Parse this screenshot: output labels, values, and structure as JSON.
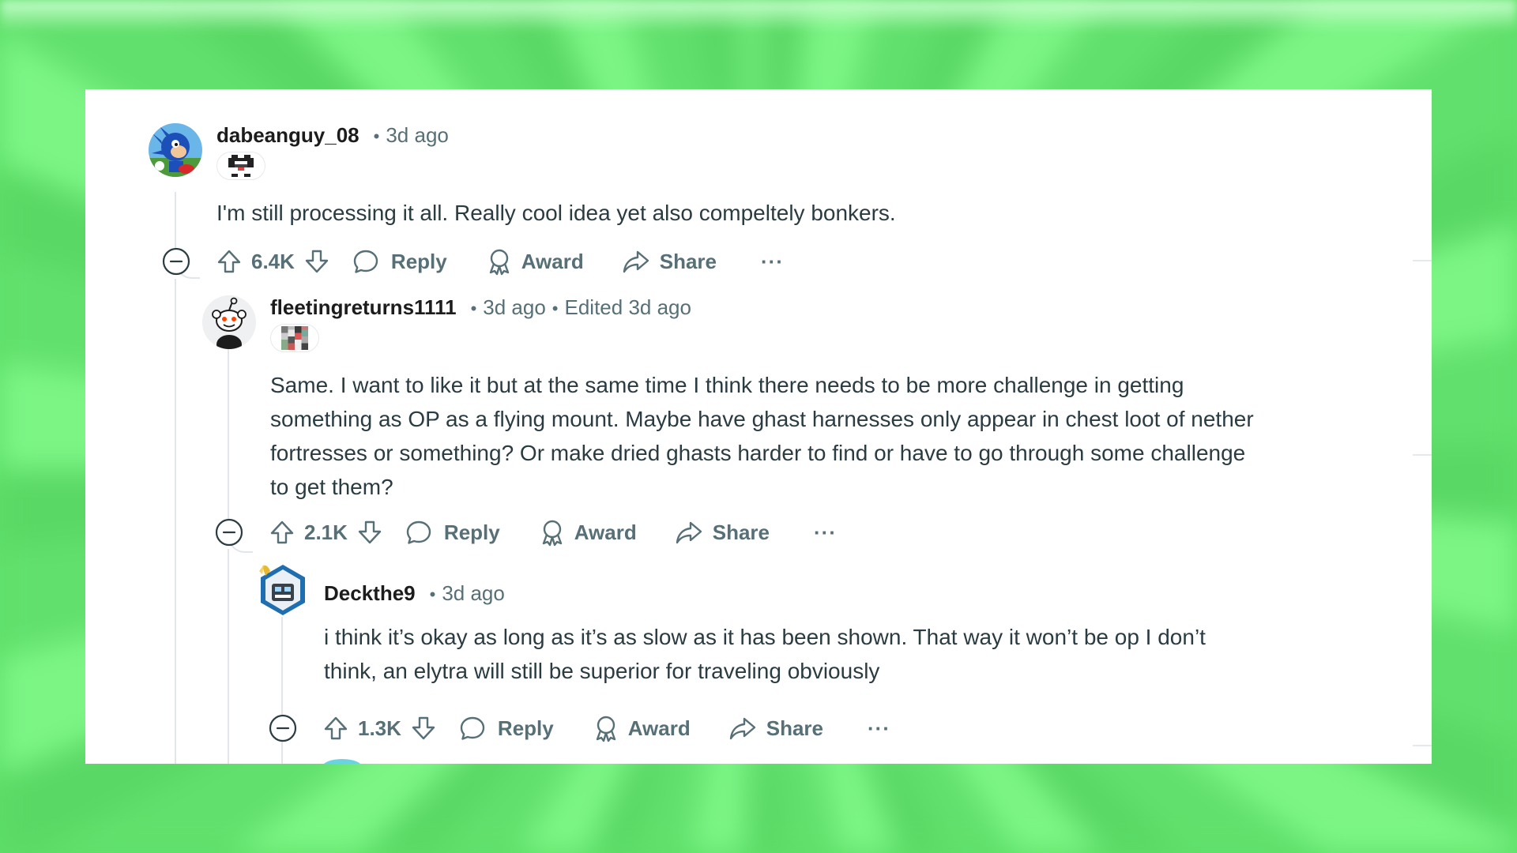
{
  "comments": [
    {
      "username": "dabeanguy_08",
      "separator": "•",
      "time": "3d ago",
      "edited": "",
      "body": "I'm still processing it all. Really cool idea yet also compeltely bonkers.",
      "votes": "6.4K",
      "avatar_icon": "sonic-avatar-icon",
      "flair_icon": "pixel-creeper-icon"
    },
    {
      "username": "fleetingreturns1111",
      "separator": "•",
      "time": "3d ago",
      "edited_separator": "•",
      "edited": "Edited 3d ago",
      "body_lines": [
        "Same. I want to like it but at the same time I think there needs to be more challenge in getting",
        "something as OP as a flying mount. Maybe have ghast harnesses only appear in chest loot of nether",
        "fortresses or something? Or make dried ghasts harder to find or have to go through some challenge",
        "to get them?"
      ],
      "votes": "2.1K",
      "avatar_icon": "snoo-avatar-icon",
      "flair_icon": "pixel-flair-icon"
    },
    {
      "username": "Deckthe9",
      "separator": "•",
      "time": "3d ago",
      "body_lines": [
        "i think it’s okay as long as it’s as slow as it has been shown. That way it won’t be op I don’t",
        "think, an elytra will still be superior for traveling obviously"
      ],
      "votes": "1.3K",
      "avatar_icon": "robot-avatar-icon"
    }
  ],
  "actions": {
    "reply": "Reply",
    "award": "Award",
    "share": "Share",
    "more": "···"
  },
  "colors": {
    "background": "#66e070",
    "card": "#ffffff",
    "text": "#2a3c42",
    "meta": "#576f76",
    "thread_line": "#e3e6e8"
  }
}
